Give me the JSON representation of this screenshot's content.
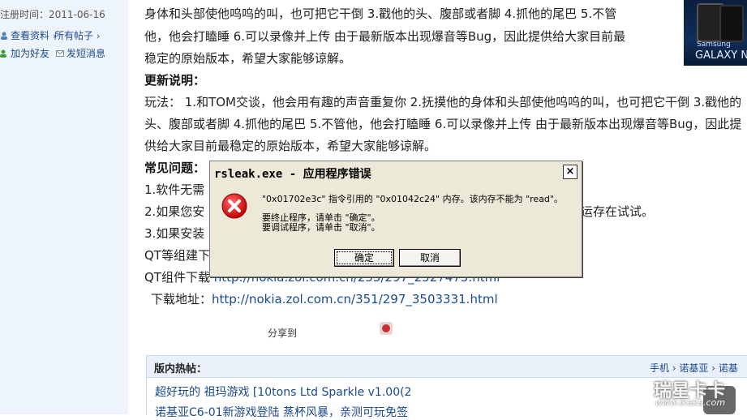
{
  "sidebar": {
    "reg_time": "注册时间：2011-06-16",
    "links": [
      "查看资料",
      "所有帖子",
      "加为好友",
      "发短消息"
    ]
  },
  "article": {
    "line1": "身体和头部使他呜呜的叫，也可把它干倒  3.戳他的头、腹部或者脚  4.抓他的尾巴  5.不管",
    "line2": "他，他会打瞌睡  6.可以录像并上传  由于最新版本出现爆音等Bug，因此提供给大家目前最",
    "line3": "稳定的原始版本，希望大家能够谅解。",
    "update_heading": "更新说明：",
    "line5": "玩法：   1.和TOM交谈，他会用有趣的声音重复你  2.抚摸他的身体和头部使他呜呜的叫，也可把它干倒  3.戳他的",
    "line6": "头、腹部或者脚  4.抓他的尾巴  5.不管他，他会打瞌睡  6.可以录像并上传  由于最新版本出现爆音等Bug，因此提",
    "line7": "供给大家目前最稳定的原始版本，希望大家能够谅解。",
    "faq_heading": "常见问题：",
    "faq1": "1.软件无需",
    "faq2": "2.如果您安",
    "faq2_tail": "运存在试试。",
    "faq3": "3.如果安装",
    "qt1": "QT等组建下",
    "qt2_label": "QT组件下载",
    "qt2_url": "http://nokia.zol.com.cn/255/297_2527475.html",
    "dl_label": "下载地址：",
    "dl_url": "http://nokia.zol.com.cn/351/297_3503331.html",
    "share": "分享到"
  },
  "ad": {
    "brand": "Samsung",
    "model": "GALAXY N"
  },
  "hot": {
    "title": "版内热帖：",
    "crumbs": "手机 › 诺基亚 › 诺基",
    "items": [
      "超好玩的 祖玛游戏 [10tons Ltd Sparkle v1.00(2",
      "诺基亚C6-01新游戏登陆 蒸杯风暴，亲测可玩免签"
    ]
  },
  "watermark": {
    "name": "瑞星卡卡",
    "url": "www.ikaka.com"
  },
  "dialog": {
    "title": "rsleak.exe - 应用程序错误",
    "msg1": "\"0x01702e3c\" 指令引用的 \"0x01042c24\" 内存。该内存不能为 \"read\"。",
    "msg2": "要终止程序，请单击 \"确定\"。",
    "msg3": "要调试程序，请单击 \"取消\"。",
    "ok": "确定",
    "cancel": "取消",
    "close": "×"
  }
}
